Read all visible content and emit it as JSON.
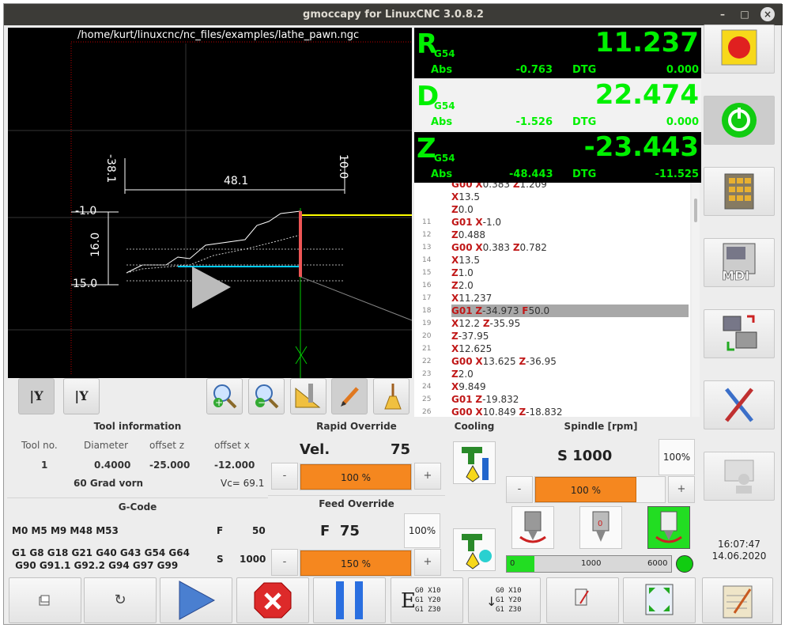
{
  "window": {
    "title": "gmoccapy for LinuxCNC  3.0.8.2"
  },
  "preview": {
    "file_path": "/home/kurt/linuxcnc/nc_files/examples/lathe_pawn.ngc",
    "dim_top_left": "-38.1",
    "dim_top_right": "10.0",
    "dim_horizontal": "48.1",
    "dim_left_top": "-1.0",
    "dim_left_mid": "16.0",
    "dim_left_bottom": "15.0"
  },
  "dro": [
    {
      "axis": "R",
      "system": "G54",
      "value": "11.237",
      "abs_label": "Abs",
      "abs": "-0.763",
      "dtg_label": "DTG",
      "dtg": "0.000"
    },
    {
      "axis": "D",
      "system": "G54",
      "value": "22.474",
      "abs_label": "Abs",
      "abs": "-1.526",
      "dtg_label": "DTG",
      "dtg": "0.000"
    },
    {
      "axis": "Z",
      "system": "G54",
      "value": "-23.443",
      "abs_label": "Abs",
      "abs": "-48.443",
      "dtg_label": "DTG",
      "dtg": "-11.525"
    }
  ],
  "gcode_lines": [
    {
      "num": "",
      "text": "G00 X0.383 Z1.209"
    },
    {
      "num": "",
      "text": "X13.5"
    },
    {
      "num": "",
      "text": "Z0.0"
    },
    {
      "num": "11",
      "text": "G01 X-1.0"
    },
    {
      "num": "12",
      "text": "Z0.488"
    },
    {
      "num": "13",
      "text": "G00 X0.383 Z0.782"
    },
    {
      "num": "14",
      "text": "X13.5"
    },
    {
      "num": "15",
      "text": "Z1.0"
    },
    {
      "num": "16",
      "text": "Z2.0"
    },
    {
      "num": "17",
      "text": "X11.237"
    },
    {
      "num": "18",
      "text": "G01 Z-34.973 F50.0"
    },
    {
      "num": "19",
      "text": "X12.2 Z-35.95"
    },
    {
      "num": "20",
      "text": "Z-37.95"
    },
    {
      "num": "21",
      "text": "X12.625"
    },
    {
      "num": "22",
      "text": "G00 X13.625 Z-36.95"
    },
    {
      "num": "23",
      "text": "Z2.0"
    },
    {
      "num": "24",
      "text": "X9.849"
    },
    {
      "num": "25",
      "text": "G01 Z-19.832"
    },
    {
      "num": "26",
      "text": "G00 X10.849 Z-18.832"
    }
  ],
  "tool_info": {
    "title": "Tool information",
    "headers": [
      "Tool no.",
      "Diameter",
      "offset z",
      "offset x"
    ],
    "values": [
      "1",
      "0.4000",
      "-25.000",
      "-12.000"
    ],
    "description": "60 Grad vorn",
    "vc": "Vc= 69.1"
  },
  "gcode_panel": {
    "title": "G-Code",
    "mcodes": "M0 M5 M9 M48 M53",
    "gcodes_1": "G1 G8 G18 G21 G40 G43 G54 G64",
    "gcodes_2": " G90 G91.1 G92.2 G94 G97 G99",
    "f_label": "F",
    "f_value": "50",
    "s_label": "S",
    "s_value": "1000"
  },
  "rapid": {
    "title": "Rapid Override",
    "label": "Vel.",
    "value": "75",
    "percent": "100 %",
    "fraction": 1.0,
    "minus": "-",
    "plus": "+"
  },
  "feed": {
    "title": "Feed Override",
    "label": "F  75",
    "reset": "100%",
    "percent": "150 %",
    "fraction": 1.0,
    "minus": "-",
    "plus": "+"
  },
  "cooling": {
    "title": "Cooling"
  },
  "spindle": {
    "title": "Spindle [rpm]",
    "speed": "S 1000",
    "reset": "100%",
    "percent": "100 %",
    "fraction": 0.78,
    "minus": "-",
    "plus": "+",
    "bar_min": "0",
    "bar_mid": "1000",
    "bar_max": "6000",
    "bar_fraction": 0.17
  },
  "clock": {
    "time": "16:07:47",
    "date": "14.06.2020"
  },
  "bottom": {
    "gcode_btn1": [
      "G0 X10",
      "G1 Y20",
      "G1 Z30"
    ],
    "gcode_btn2": [
      "G0 X10",
      "G1 Y20",
      "G1 Z30"
    ]
  },
  "colors": {
    "dro_green": "#00f000",
    "accent_orange": "#f5871f",
    "highlight": "#a8a8a8"
  }
}
